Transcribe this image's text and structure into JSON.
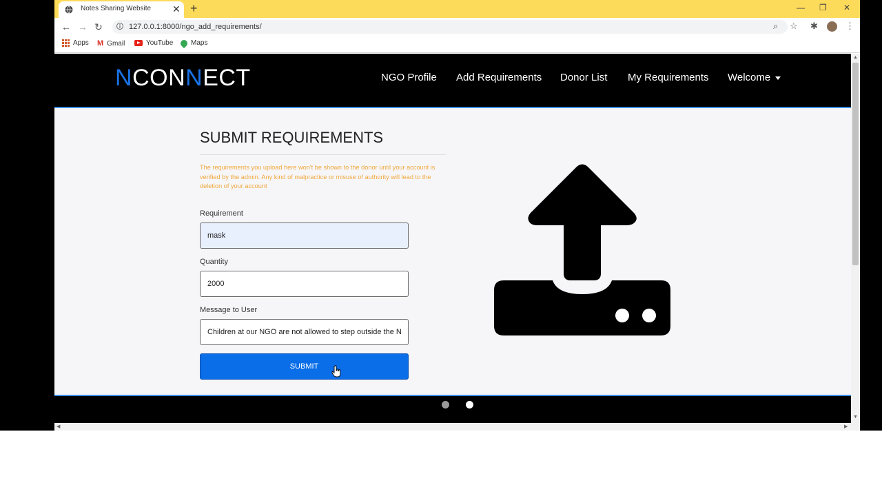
{
  "browser": {
    "tab_title": "Notes Sharing Website",
    "tab_close": "✕",
    "new_tab": "+",
    "window_controls": {
      "minimize": "—",
      "restore": "❐",
      "close": "✕"
    },
    "nav": {
      "back": "←",
      "forward": "→",
      "reload": "↻"
    },
    "url": "127.0.0.1:8000/ngo_add_requirements/",
    "toolbar_icons": {
      "zoom": "⌕",
      "star": "☆",
      "extensions": "✱",
      "menu": "⋮"
    },
    "bookmarks": [
      {
        "label": "Apps",
        "icon": "apps-grid-icon"
      },
      {
        "label": "Gmail",
        "icon": "gmail-icon"
      },
      {
        "label": "YouTube",
        "icon": "youtube-icon"
      },
      {
        "label": "Maps",
        "icon": "maps-icon"
      }
    ]
  },
  "site": {
    "logo": {
      "part1": "N",
      "part2": "CON",
      "part3": "N",
      "part4": "ECT"
    },
    "nav_links": [
      "NGO Profile",
      "Add Requirements",
      "Donor List",
      "My Requirements",
      "Welcome"
    ],
    "brand_accent": "#1a73e8"
  },
  "form": {
    "heading": "SUBMIT REQUIREMENTS",
    "notice": "The requirements you upload here won't be shown to the donor until your account is verified by the admin. Any kind of malpractice or misuse of authority will lead to the deletion of your account",
    "notice_color": "#f0a83c",
    "requirement_label": "Requirement",
    "requirement_value": "mask",
    "quantity_label": "Quantity",
    "quantity_value": "2000",
    "message_label": "Message to User",
    "message_value": "Children at our NGO are not allowed to step outside the N",
    "submit_label": "SUBMIT",
    "submit_color": "#0a6ee8"
  },
  "carousel": {
    "slide_count": 2,
    "active_slide": 2
  },
  "scrollbar": {
    "up": "▲",
    "down": "▼",
    "left": "◀",
    "right": "▶"
  }
}
